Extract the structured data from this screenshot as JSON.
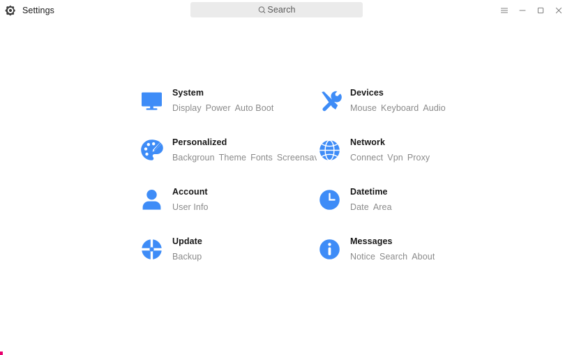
{
  "window": {
    "title": "Settings",
    "icon": "gear-icon",
    "accent_color": "#3e8cf7",
    "title_color": "#1a1a1a",
    "background": "#ffffff"
  },
  "search": {
    "placeholder": "Search",
    "icon": "search-icon",
    "background": "#ebebeb"
  },
  "window_controls": [
    {
      "name": "menu",
      "icon": "hamburger-menu-icon"
    },
    {
      "name": "minimize",
      "icon": "minimize-icon"
    },
    {
      "name": "maximize",
      "icon": "maximize-icon"
    },
    {
      "name": "close",
      "icon": "close-icon"
    }
  ],
  "categories": [
    {
      "id": "system",
      "title": "System",
      "icon": "monitor-icon",
      "subs": [
        "Display",
        "Power",
        "Auto Boot"
      ]
    },
    {
      "id": "devices",
      "title": "Devices",
      "icon": "tools-icon",
      "subs": [
        "Mouse",
        "Keyboard",
        "Audio"
      ]
    },
    {
      "id": "personalized",
      "title": "Personalized",
      "icon": "palette-icon",
      "subs": [
        "Backgroun",
        "Theme",
        "Fonts",
        "Screensaver"
      ]
    },
    {
      "id": "network",
      "title": "Network",
      "icon": "globe-icon",
      "subs": [
        "Connect",
        "Vpn",
        "Proxy"
      ]
    },
    {
      "id": "account",
      "title": "Account",
      "icon": "user-icon",
      "subs": [
        "User Info"
      ]
    },
    {
      "id": "datetime",
      "title": "Datetime",
      "icon": "clock-icon",
      "subs": [
        "Date",
        "Area"
      ]
    },
    {
      "id": "update",
      "title": "Update",
      "icon": "update-icon",
      "subs": [
        "Backup"
      ]
    },
    {
      "id": "messages",
      "title": "Messages",
      "icon": "info-icon",
      "subs": [
        "Notice",
        "Search",
        "About"
      ]
    }
  ]
}
